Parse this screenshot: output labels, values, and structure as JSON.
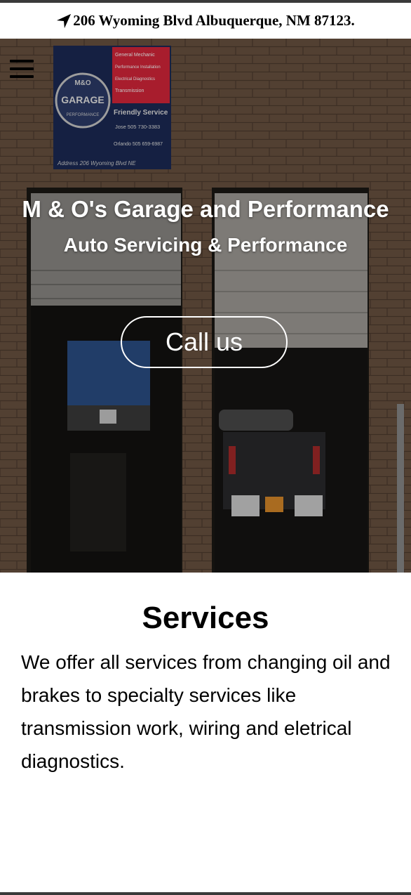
{
  "topbar": {
    "address": "206 Wyoming Blvd Albuquerque, NM 87123.",
    "icon": "location-arrow-icon"
  },
  "hero": {
    "menu_icon": "hamburger-menu-icon",
    "title": "M & O's Garage and Performance",
    "subtitle": "Auto Servicing & Performance",
    "call_button": "Call us",
    "sign": {
      "brand_top": "M&O",
      "brand_main": "GARAGE",
      "brand_bottom": "PERFORMANCE",
      "services": [
        "General Mechanic",
        "Performance Installation",
        "Electrical Diagnostics",
        "Transmission"
      ],
      "tagline": "Friendly Service",
      "contact_1": "Jose 505 730-3383",
      "contact_2": "Orlando 505 659-6987",
      "address": "Address 206 Wyoming Blvd NE"
    },
    "colors": {
      "sign_red": "#d8263a",
      "sign_blue": "#1b2a55",
      "wall": "#6e5540"
    }
  },
  "services": {
    "heading": "Services",
    "body": "We offer all services from changing oil and brakes to specialty services like transmission work, wiring and eletrical diagnostics."
  }
}
